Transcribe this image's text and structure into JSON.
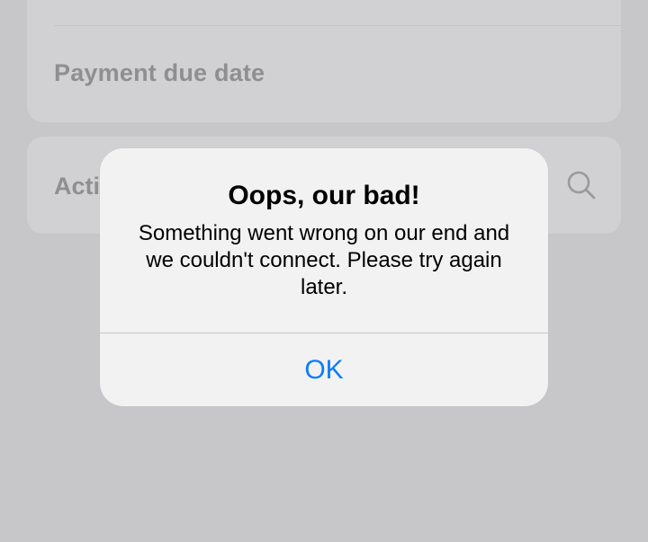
{
  "background": {
    "payment_due_label": "Payment due date",
    "search_row_label": "Acti",
    "search_icon": "search-icon"
  },
  "alert": {
    "title": "Oops, our bad!",
    "message": "Something went wrong on our end and we couldn't connect. Please try again later.",
    "ok_label": "OK"
  },
  "colors": {
    "overlay_background": "#c7c7c9",
    "card_background": "#d1d1d3",
    "alert_background": "#f2f2f2",
    "button_text": "#0a7cff"
  }
}
